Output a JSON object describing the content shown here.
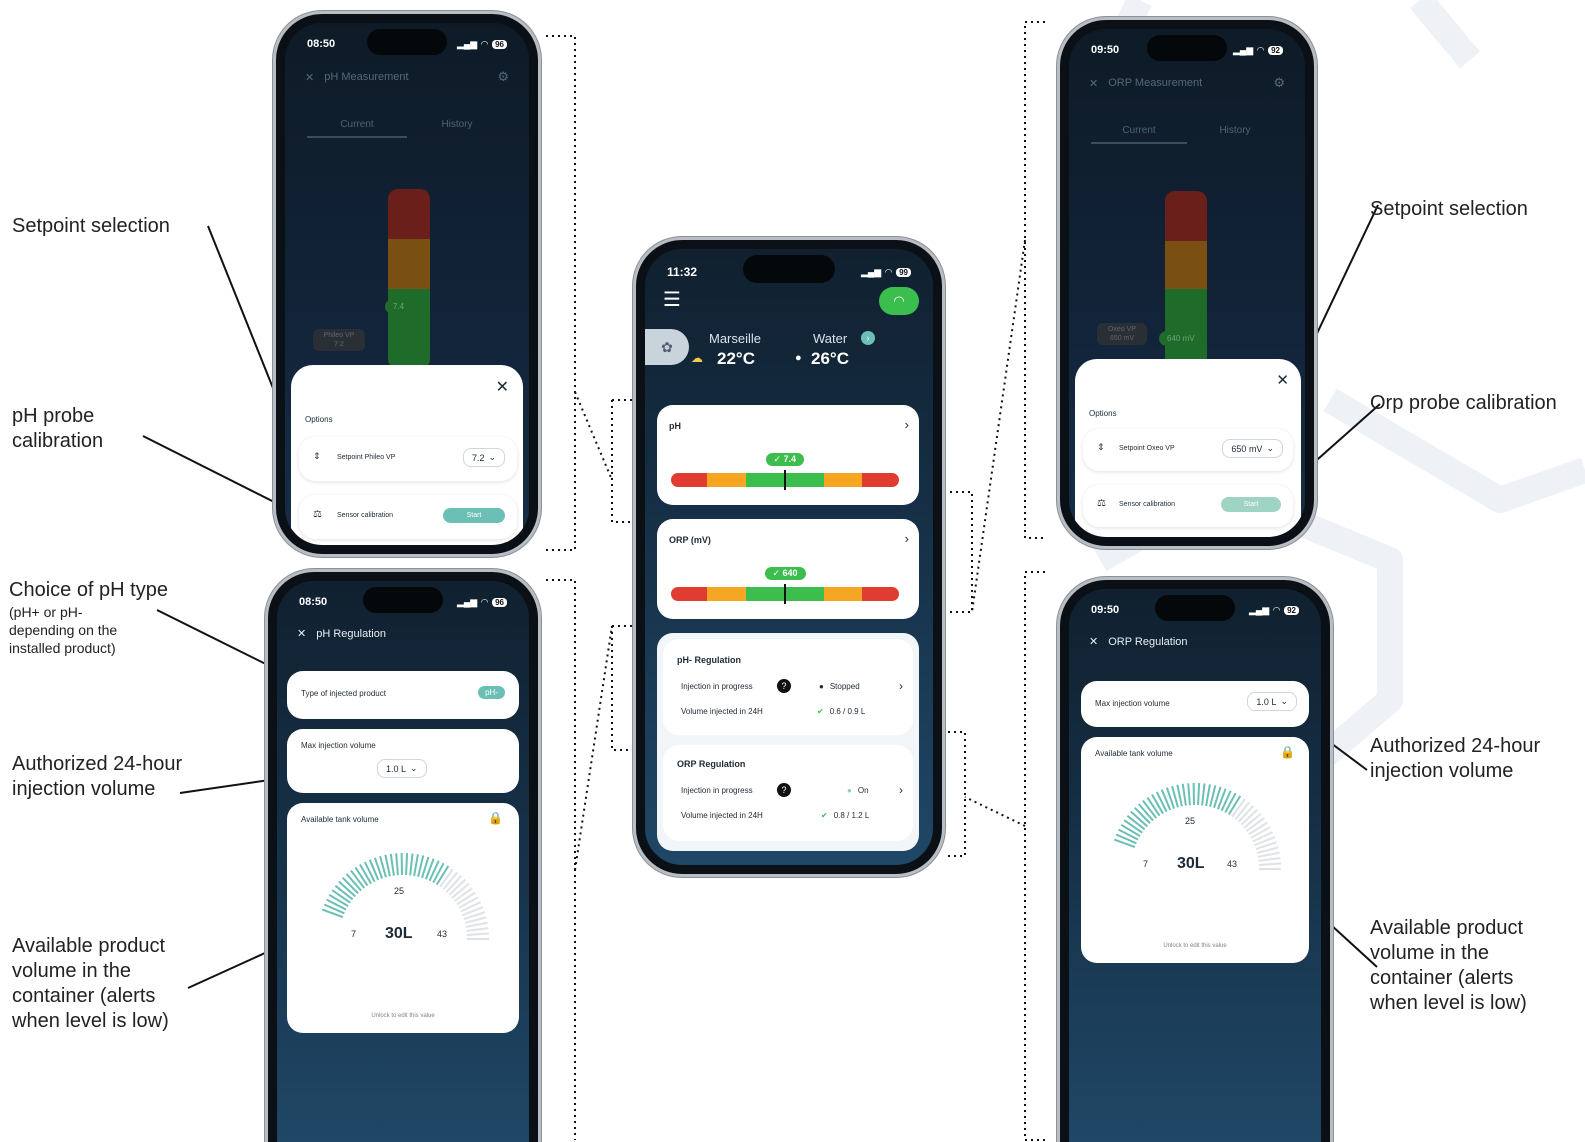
{
  "callouts": {
    "left_setpoint": "Setpoint selection",
    "left_calibration": "pH probe calibration",
    "left_ph_type": "Choice of pH type",
    "left_ph_type_note": "(pH+ or pH- depending on the installed product)",
    "left_authorized": "Authorized 24-hour injection volume",
    "left_available": "Available product volume in the container (alerts when level is low)",
    "right_setpoint": "Setpoint selection",
    "right_calibration": "Orp probe calibration",
    "right_authorized": "Authorized 24-hour injection volume",
    "right_available": "Available product volume in the container (alerts when level is low)"
  },
  "ph_measurement": {
    "time": "08:50",
    "battery": "96",
    "title": "pH Measurement",
    "tab_current": "Current",
    "tab_history": "History",
    "gauge_value": "7.4",
    "gauge_tag": "Phileo VP 7.2",
    "options_label": "Options",
    "setpoint_label": "Setpoint Phileo VP",
    "setpoint_value": "7.2",
    "calibration_label": "Sensor calibration",
    "start_label": "Start"
  },
  "orp_measurement": {
    "time": "09:50",
    "battery": "92",
    "title": "ORP Measurement",
    "tab_current": "Current",
    "tab_history": "History",
    "gauge_value": "640 mV",
    "gauge_tag": "Oxeo VP 650 mV",
    "options_label": "Options",
    "setpoint_label": "Setpoint Oxeo VP",
    "setpoint_value": "650 mV",
    "calibration_label": "Sensor calibration",
    "start_label": "Start"
  },
  "home": {
    "time": "11:32",
    "battery": "99",
    "city": "Marseille",
    "air_temp": "22°C",
    "water_label": "Water",
    "water_temp": "26°C",
    "ph_card_title": "pH",
    "ph_value": "7.4",
    "ph_fraction": 0.5,
    "orp_card_title": "ORP (mV)",
    "orp_value": "640",
    "orp_fraction": 0.5,
    "ph_reg_title": "pH- Regulation",
    "ph_reg_injection_label": "Injection in progress",
    "ph_reg_status": "Stopped",
    "ph_reg_volume_label": "Volume injected in 24H",
    "ph_reg_volume": "0.6 / 0.9 L",
    "orp_reg_title": "ORP Regulation",
    "orp_reg_injection_label": "Injection in progress",
    "orp_reg_status": "On",
    "orp_reg_volume_label": "Volume injected in 24H",
    "orp_reg_volume": "0.8 / 1.2 L"
  },
  "ph_regulation": {
    "time": "08:50",
    "battery": "96",
    "title": "pH Regulation",
    "type_label": "Type of injected product",
    "type_value": "pH-",
    "max_label": "Max injection volume",
    "max_value": "1.0 L",
    "tank_label": "Available tank volume",
    "tank_min": "7",
    "tank_mid": "25",
    "tank_max": "43",
    "tank_value": "30L",
    "unlock_text": "Unlock to edit this value"
  },
  "orp_regulation": {
    "time": "09:50",
    "battery": "92",
    "title": "ORP Regulation",
    "max_label": "Max injection volume",
    "max_value": "1.0 L",
    "tank_label": "Available tank volume",
    "tank_min": "7",
    "tank_mid": "25",
    "tank_max": "43",
    "tank_value": "30L",
    "unlock_text": "Unlock to edit this value"
  },
  "colors": {
    "red": "#e03c31",
    "orange": "#f5a623",
    "green": "#3cbe4e",
    "teal": "#6bbfb4",
    "wifi_green": "#3cbe4e"
  }
}
